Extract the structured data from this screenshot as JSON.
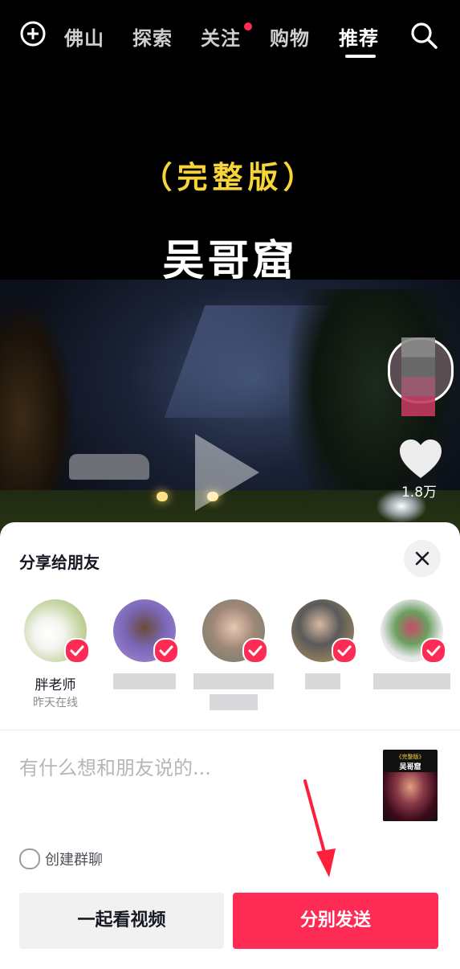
{
  "nav": {
    "tabs": [
      "佛山",
      "探索",
      "关注",
      "购物",
      "推荐"
    ],
    "active_tab": "推荐",
    "has_notification_dot": true
  },
  "video": {
    "title_line1": "（完整版）",
    "title_line2": "吴哥窟",
    "like_count": "1.8万"
  },
  "share_sheet": {
    "title": "分享给朋友",
    "friends": [
      {
        "name": "胖老师",
        "status": "昨天在线",
        "selected": true
      },
      {
        "name": "",
        "status": "",
        "selected": true
      },
      {
        "name": "",
        "status": "",
        "selected": true
      },
      {
        "name": "",
        "status": "",
        "selected": true
      },
      {
        "name": "",
        "status": "",
        "selected": true
      }
    ],
    "message_placeholder": "有什么想和朋友说的...",
    "thumbnail": {
      "line1": "《完整版》",
      "line2": "吴哥窟"
    },
    "create_group_label": "创建群聊",
    "watch_together_label": "一起看视频",
    "send_label": "分别发送"
  },
  "colors": {
    "accent": "#fe2c55",
    "title_yellow": "#f7d437"
  }
}
